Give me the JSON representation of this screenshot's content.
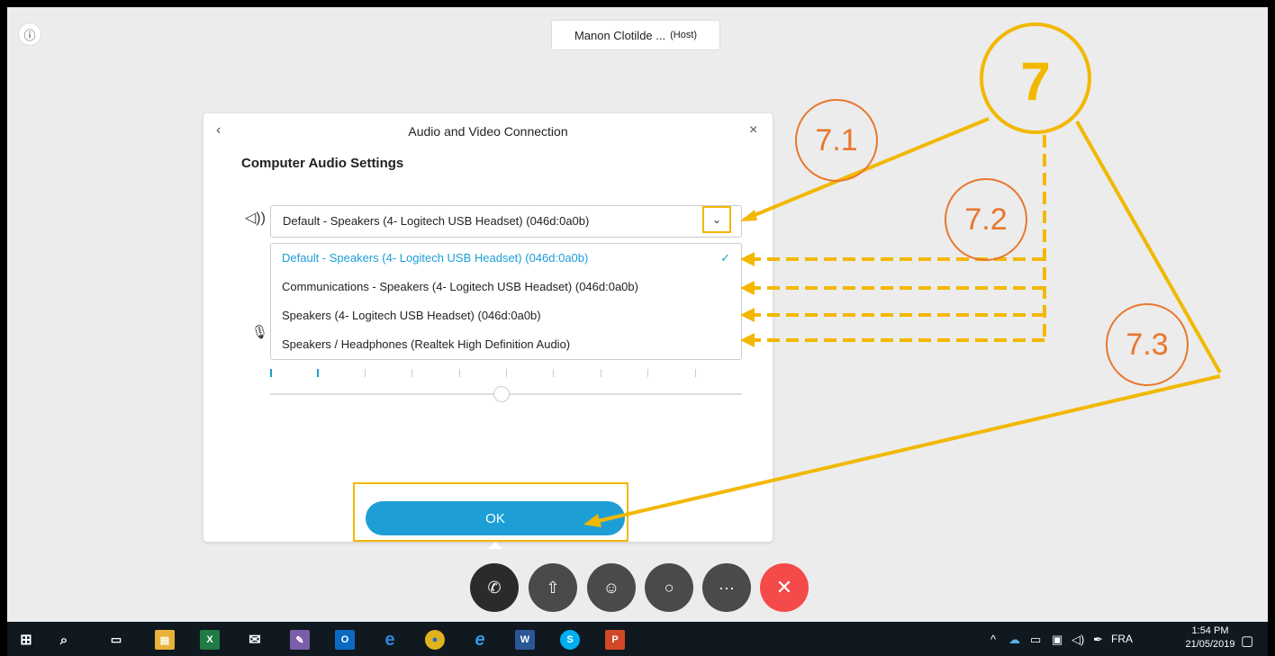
{
  "meeting": {
    "info_icon": "info-icon",
    "host_name": "Manon Clotilde ...",
    "host_role": "(Host)"
  },
  "dialog": {
    "title": "Audio and Video Connection",
    "back_icon": "chevron-left-icon",
    "close_icon": "close-icon",
    "subtitle": "Computer Audio Settings",
    "speaker_selected": "Default - Speakers (4- Logitech USB Headset) (046d:0a0b)",
    "speaker_options": [
      "Default - Speakers (4- Logitech USB Headset) (046d:0a0b)",
      "Communications - Speakers (4- Logitech USB Headset) (046d:0a0b)",
      "Speakers (4- Logitech USB Headset) (046d:0a0b)",
      "Speakers / Headphones (Realtek High Definition Audio)"
    ],
    "speaker_level_active_ticks": 2,
    "speaker_level_total_ticks": 10,
    "volume_fraction": 0.49,
    "ok_label": "OK",
    "accent_color": "#1d9fd6"
  },
  "controls": [
    {
      "name": "audio-connection",
      "icon": "phone-icon"
    },
    {
      "name": "share",
      "icon": "upload-icon"
    },
    {
      "name": "participants",
      "icon": "people-icon"
    },
    {
      "name": "chat",
      "icon": "chat-icon"
    },
    {
      "name": "more",
      "icon": "more-icon"
    },
    {
      "name": "leave",
      "icon": "close-icon"
    }
  ],
  "annotations": {
    "main": "7",
    "step1": "7.1",
    "step2": "7.2",
    "step3": "7.3",
    "main_color": "#f2b800",
    "sub_color": "#e8772e"
  },
  "taskbar": {
    "apps": [
      "start",
      "search",
      "task-view",
      "file-explorer",
      "excel",
      "mail",
      "paint",
      "outlook",
      "edge",
      "chrome",
      "internet-explorer",
      "word",
      "skype",
      "powerpoint"
    ],
    "language": "FRA",
    "time": "1:54 PM",
    "date": "21/05/2019"
  }
}
